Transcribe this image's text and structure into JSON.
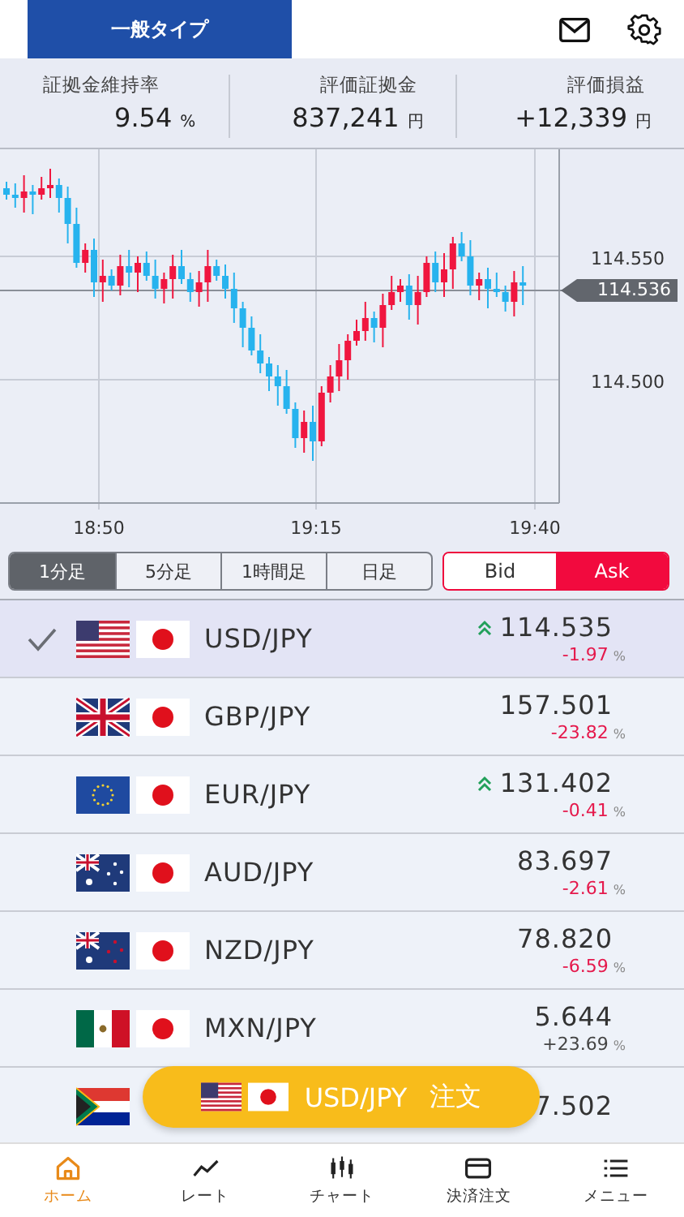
{
  "header": {
    "account_type": "一般タイプ"
  },
  "stats": [
    {
      "label": "証拠金維持率",
      "value": "9.54",
      "unit": "%"
    },
    {
      "label": "評価証拠金",
      "value": "837,241",
      "unit": "円"
    },
    {
      "label": "評価損益",
      "value": "+12,339",
      "unit": "円"
    }
  ],
  "chart": {
    "y_ticks": [
      "114.550",
      "114.500"
    ],
    "current_price": "114.536",
    "x_ticks": [
      "18:50",
      "19:15",
      "19:40"
    ]
  },
  "timeframes": [
    {
      "label": "1分足",
      "selected": true
    },
    {
      "label": "5分足",
      "selected": false
    },
    {
      "label": "1時間足",
      "selected": false
    },
    {
      "label": "日足",
      "selected": false
    }
  ],
  "price_sides": [
    {
      "label": "Bid",
      "selected": false
    },
    {
      "label": "Ask",
      "selected": true
    }
  ],
  "pairs": [
    {
      "flags": [
        {
          "kind": "us"
        },
        {
          "kind": "jp"
        }
      ],
      "name": "USD/JPY",
      "selected": true,
      "rising": true,
      "price": "114.535",
      "change": {
        "text": "-1.97",
        "unit": "%",
        "color": "#e5194c"
      }
    },
    {
      "flags": [
        {
          "kind": "gb"
        },
        {
          "kind": "jp"
        }
      ],
      "name": "GBP/JPY",
      "selected": false,
      "rising": false,
      "price": "157.501",
      "change": {
        "text": "-23.82",
        "unit": "%",
        "color": "#e5194c"
      }
    },
    {
      "flags": [
        {
          "kind": "eu"
        },
        {
          "kind": "jp"
        }
      ],
      "name": "EUR/JPY",
      "selected": false,
      "rising": true,
      "price": "131.402",
      "change": {
        "text": "-0.41",
        "unit": "%",
        "color": "#e5194c"
      }
    },
    {
      "flags": [
        {
          "kind": "au"
        },
        {
          "kind": "jp"
        }
      ],
      "name": "AUD/JPY",
      "selected": false,
      "rising": false,
      "price": "83.697",
      "change": {
        "text": "-2.61",
        "unit": "%",
        "color": "#e5194c"
      }
    },
    {
      "flags": [
        {
          "kind": "nz"
        },
        {
          "kind": "jp"
        }
      ],
      "name": "NZD/JPY",
      "selected": false,
      "rising": false,
      "price": "78.820",
      "change": {
        "text": "-6.59",
        "unit": "%",
        "color": "#e5194c"
      }
    },
    {
      "flags": [
        {
          "kind": "mx"
        },
        {
          "kind": "jp"
        }
      ],
      "name": "MXN/JPY",
      "selected": false,
      "rising": false,
      "price": "5.644",
      "change": {
        "text": "+23.69",
        "unit": "%",
        "color": "#444444"
      }
    },
    {
      "flags": [
        {
          "kind": "za"
        }
      ],
      "price": "7.502"
    }
  ],
  "order_button": {
    "flags": [
      {
        "kind": "us"
      },
      {
        "kind": "jp"
      }
    ],
    "pair": "USD/JPY",
    "action": "注文"
  },
  "nav": [
    {
      "kind": "home",
      "label": "ホーム",
      "selected": true
    },
    {
      "kind": "rate",
      "label": "レート",
      "selected": false
    },
    {
      "kind": "chart",
      "label": "チャート",
      "selected": false
    },
    {
      "kind": "card",
      "label": "決済注文",
      "selected": false
    },
    {
      "kind": "menu",
      "label": "メニュー",
      "selected": false
    }
  ]
}
